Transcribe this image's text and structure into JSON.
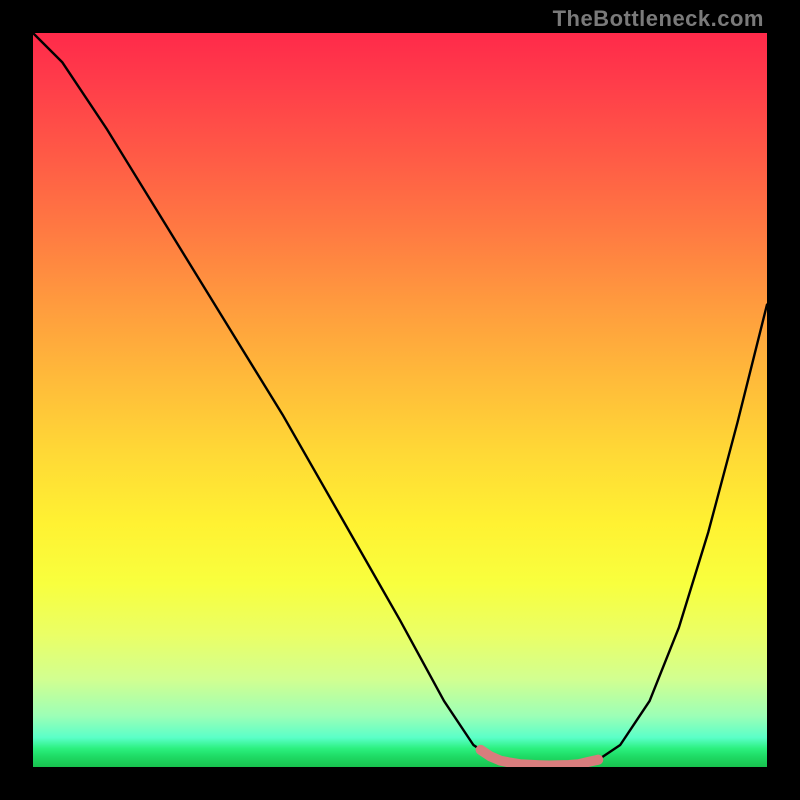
{
  "watermark": "TheBottleneck.com",
  "colors": {
    "background": "#000000",
    "curve": "#000000",
    "bottom_highlight": "#d87d7d"
  },
  "chart_data": {
    "type": "line",
    "title": "",
    "xlabel": "",
    "ylabel": "",
    "xlim": [
      0,
      100
    ],
    "ylim": [
      0,
      100
    ],
    "x": [
      0,
      4,
      10,
      18,
      26,
      34,
      42,
      50,
      56,
      60,
      63,
      66,
      70,
      74,
      77,
      80,
      84,
      88,
      92,
      96,
      100
    ],
    "values": [
      100,
      96,
      87,
      74,
      61,
      48,
      34,
      20,
      9,
      3,
      1,
      0.4,
      0.2,
      0.3,
      1,
      3,
      9,
      19,
      32,
      47,
      63
    ],
    "bottom_segment": {
      "x_start": 61,
      "x_end": 77
    },
    "description": "V-shaped bottleneck curve over vertical red-to-green gradient. Minimum (optimal) region highlighted in salmon at the trough.",
    "grid": false,
    "legend": false
  }
}
